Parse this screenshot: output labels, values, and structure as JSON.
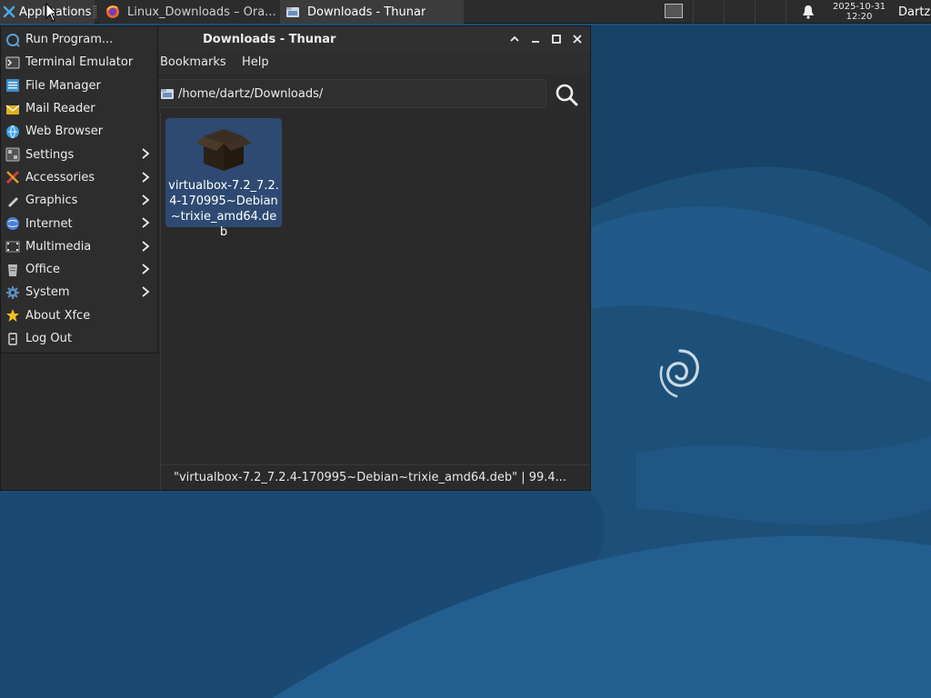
{
  "panel": {
    "applications_label": "Applications",
    "tasks": [
      {
        "label": "Linux_Downloads – Ora...",
        "icon": "firefox-icon"
      },
      {
        "label": "Downloads - Thunar",
        "icon": "folder-icon"
      }
    ],
    "clock": {
      "date": "2025-10-31",
      "time": "12:20"
    },
    "user": "Dartz"
  },
  "window": {
    "title": "Downloads - Thunar",
    "menus": [
      "Bookmarks",
      "Help"
    ],
    "location": "/home/dartz/Downloads/",
    "file": {
      "name": "virtualbox-7.2_7.2.4-170995~Debian~trixie_amd64.deb",
      "icon": "package-icon"
    },
    "status": "\"virtualbox-7.2_7.2.4-170995~Debian~trixie_amd64.deb\"  |  99.4..."
  },
  "app_menu": {
    "items": [
      {
        "label": "Run Program...",
        "icon": "run-program-icon",
        "submenu": false,
        "color": "#5aa0d8"
      },
      {
        "label": "Terminal Emulator",
        "icon": "terminal-icon",
        "submenu": false,
        "color": "#444444"
      },
      {
        "label": "File Manager",
        "icon": "file-manager-icon",
        "submenu": false,
        "color": "#3a8ed0"
      },
      {
        "label": "Mail Reader",
        "icon": "mail-icon",
        "submenu": false,
        "color": "#e0b020"
      },
      {
        "label": "Web Browser",
        "icon": "web-browser-icon",
        "submenu": false,
        "color": "#3aa0e0"
      },
      {
        "label": "Settings",
        "icon": "settings-icon",
        "submenu": true,
        "color": "#bbbbbb"
      },
      {
        "label": "Accessories",
        "icon": "accessories-icon",
        "submenu": true,
        "color": "#d04040"
      },
      {
        "label": "Graphics",
        "icon": "graphics-icon",
        "submenu": true,
        "color": "#cccccc"
      },
      {
        "label": "Internet",
        "icon": "internet-icon",
        "submenu": true,
        "color": "#4a80d0"
      },
      {
        "label": "Multimedia",
        "icon": "multimedia-icon",
        "submenu": true,
        "color": "#999999"
      },
      {
        "label": "Office",
        "icon": "office-icon",
        "submenu": true,
        "color": "#bbbbbb"
      },
      {
        "label": "System",
        "icon": "system-icon",
        "submenu": true,
        "color": "#5a90c0"
      },
      {
        "label": "About Xfce",
        "icon": "about-star-icon",
        "submenu": false,
        "color": "#f0c020"
      },
      {
        "label": "Log Out",
        "icon": "log-out-icon",
        "submenu": false,
        "color": "#dddddd"
      }
    ]
  },
  "colors": {
    "accent": "#2e4a72",
    "panel_bg": "#2c2c2c",
    "window_bg": "#2b2b2b",
    "desktop_bg": "#1c4f7a"
  }
}
